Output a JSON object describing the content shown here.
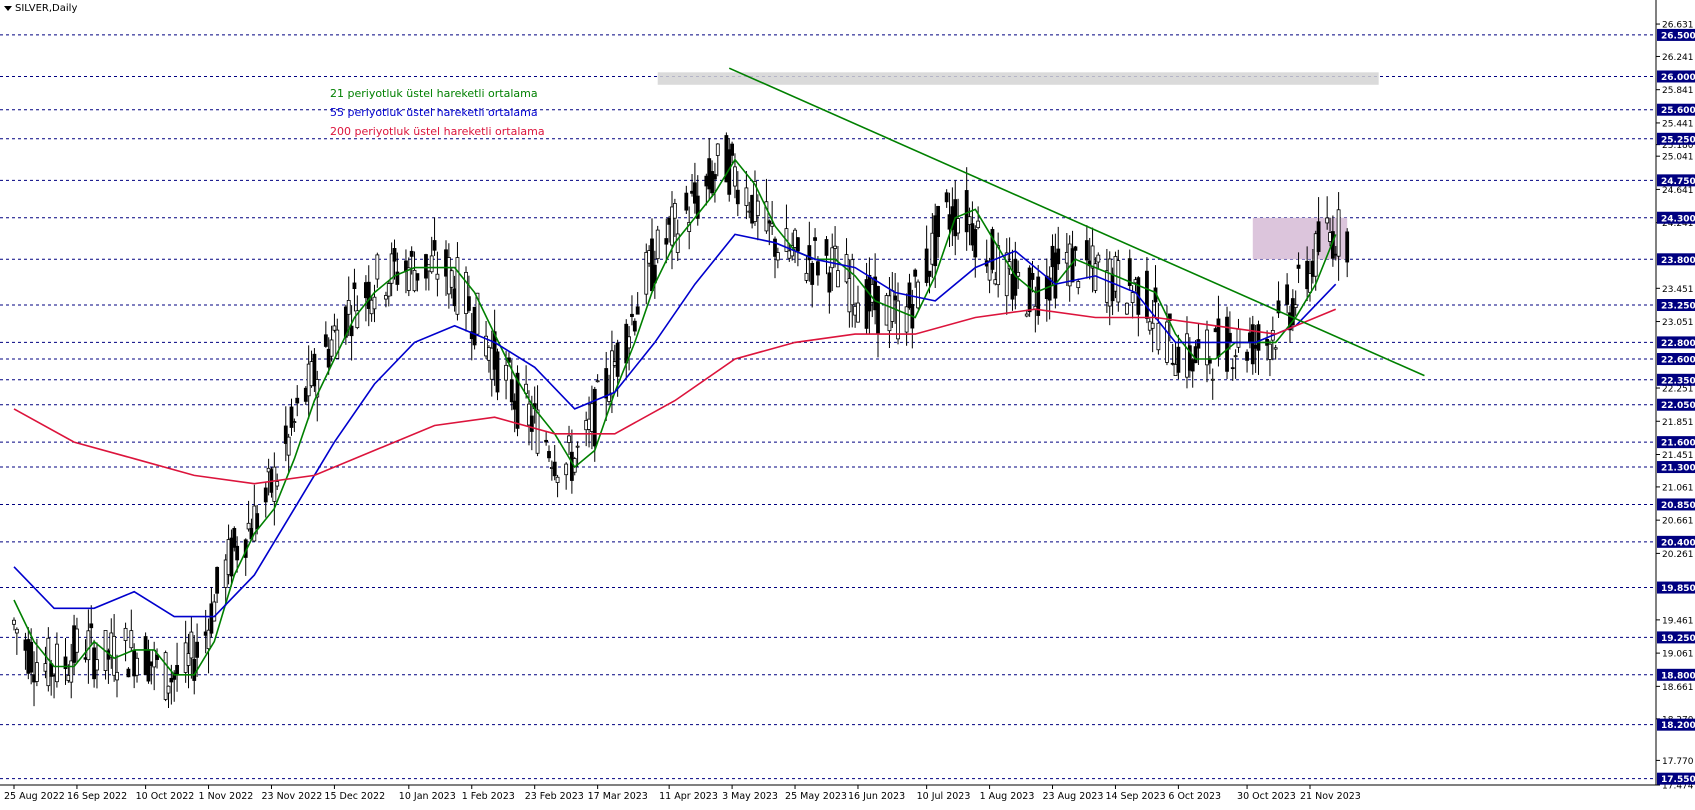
{
  "header": {
    "symbol": "SILVER,Daily"
  },
  "legend": [
    {
      "label": "21 periyotluk üstel hareketli ortalama",
      "color": "#008000"
    },
    {
      "label": "55 periyotluk üstel hareketli ortalama",
      "color": "#0000cd"
    },
    {
      "label": "200 periyotluk üstel hareketli ortalama",
      "color": "#dc143c"
    }
  ],
  "chart_data": {
    "type": "line",
    "xlabel": "",
    "ylabel": "",
    "ylim": [
      17.474,
      26.8
    ],
    "x_ticks": [
      "25 Aug 2022",
      "16 Sep 2022",
      "10 Oct 2022",
      "1 Nov 2022",
      "23 Nov 2022",
      "15 Dec 2022",
      "10 Jan 2023",
      "1 Feb 2023",
      "23 Feb 2023",
      "17 Mar 2023",
      "11 Apr 2023",
      "3 May 2023",
      "25 May 2023",
      "16 Jun 2023",
      "10 Jul 2023",
      "1 Aug 2023",
      "23 Aug 2023",
      "14 Sep 2023",
      "6 Oct 2023",
      "30 Oct 2023",
      "21 Nov 2023"
    ],
    "y_ticks": [
      "26.631",
      "26.241",
      "25.841",
      "25.441",
      "25.180",
      "25.041",
      "24.641",
      "24.241",
      "23.451",
      "23.051",
      "22.251",
      "21.851",
      "21.451",
      "21.061",
      "20.661",
      "20.261",
      "19.461",
      "19.061",
      "18.661",
      "18.270",
      "17.770",
      "17.474"
    ],
    "levels": [
      "26.500",
      "26.000",
      "25.600",
      "25.250",
      "24.750",
      "24.300",
      "23.800",
      "23.250",
      "22.800",
      "22.600",
      "22.350",
      "22.050",
      "21.600",
      "21.300",
      "20.850",
      "20.400",
      "19.850",
      "19.250",
      "18.800",
      "18.200",
      "17.550"
    ],
    "colors": {
      "ema21": "#008000",
      "ema55": "#0000cd",
      "ema200": "#dc143c",
      "candles": "#000000",
      "levels": "#000080",
      "trendline": "#008000",
      "resistance_zone": "#d3d3d3",
      "breakout_zone": "#d8bfd8",
      "label_box": "#000080"
    },
    "series": [
      {
        "name": "21 periyotluk üstel hareketli ortalama",
        "type": "line",
        "x": [
          "2022-08-25",
          "2022-09-01",
          "2022-09-08",
          "2022-09-15",
          "2022-09-22",
          "2022-09-29",
          "2022-10-06",
          "2022-10-13",
          "2022-10-20",
          "2022-10-27",
          "2022-11-03",
          "2022-11-10",
          "2022-11-17",
          "2022-11-24",
          "2022-12-01",
          "2022-12-08",
          "2022-12-15",
          "2022-12-22",
          "2022-12-29",
          "2023-01-05",
          "2023-01-12",
          "2023-01-19",
          "2023-01-26",
          "2023-02-02",
          "2023-02-09",
          "2023-02-16",
          "2023-02-23",
          "2023-03-02",
          "2023-03-09",
          "2023-03-16",
          "2023-03-23",
          "2023-03-30",
          "2023-04-06",
          "2023-04-13",
          "2023-04-20",
          "2023-04-27",
          "2023-05-04",
          "2023-05-11",
          "2023-05-18",
          "2023-05-25",
          "2023-06-01",
          "2023-06-08",
          "2023-06-15",
          "2023-06-22",
          "2023-06-29",
          "2023-07-06",
          "2023-07-13",
          "2023-07-20",
          "2023-07-27",
          "2023-08-03",
          "2023-08-10",
          "2023-08-17",
          "2023-08-24",
          "2023-08-31",
          "2023-09-07",
          "2023-09-14",
          "2023-09-21",
          "2023-09-28",
          "2023-10-05",
          "2023-10-12",
          "2023-10-19",
          "2023-10-26",
          "2023-11-02",
          "2023-11-09",
          "2023-11-16",
          "2023-11-23",
          "2023-11-30"
        ],
        "values": [
          19.7,
          19.2,
          18.9,
          18.9,
          19.2,
          19.0,
          19.1,
          19.1,
          18.8,
          18.8,
          19.2,
          20.0,
          20.5,
          20.8,
          21.4,
          22.1,
          22.6,
          23.1,
          23.4,
          23.6,
          23.7,
          23.7,
          23.7,
          23.4,
          22.9,
          22.4,
          22.0,
          21.7,
          21.3,
          21.5,
          22.2,
          22.8,
          23.5,
          24.0,
          24.3,
          24.6,
          25.0,
          24.7,
          24.2,
          23.9,
          23.8,
          23.8,
          23.6,
          23.3,
          23.2,
          23.1,
          23.6,
          24.3,
          24.4,
          24.0,
          23.6,
          23.4,
          23.5,
          23.8,
          23.7,
          23.6,
          23.5,
          23.4,
          22.9,
          22.6,
          22.6,
          22.8,
          22.8,
          22.8,
          23.1,
          23.5,
          24.1
        ]
      },
      {
        "name": "55 periyotluk üstel hareketli ortalama",
        "type": "line",
        "x": [
          "2022-08-25",
          "2022-09-08",
          "2022-09-22",
          "2022-10-06",
          "2022-10-20",
          "2022-11-03",
          "2022-11-17",
          "2022-12-01",
          "2022-12-15",
          "2022-12-29",
          "2023-01-12",
          "2023-01-26",
          "2023-02-09",
          "2023-02-23",
          "2023-03-09",
          "2023-03-23",
          "2023-04-06",
          "2023-04-20",
          "2023-05-04",
          "2023-05-18",
          "2023-06-01",
          "2023-06-15",
          "2023-06-29",
          "2023-07-13",
          "2023-07-27",
          "2023-08-10",
          "2023-08-24",
          "2023-09-07",
          "2023-09-21",
          "2023-10-05",
          "2023-10-19",
          "2023-11-02",
          "2023-11-16",
          "2023-11-30"
        ],
        "values": [
          20.1,
          19.6,
          19.6,
          19.8,
          19.5,
          19.5,
          20.0,
          20.8,
          21.6,
          22.3,
          22.8,
          23.0,
          22.8,
          22.5,
          22.0,
          22.2,
          22.8,
          23.5,
          24.1,
          24.0,
          23.8,
          23.7,
          23.4,
          23.3,
          23.7,
          23.9,
          23.5,
          23.6,
          23.4,
          22.8,
          22.8,
          22.8,
          23.0,
          23.5
        ]
      },
      {
        "name": "200 periyotluk üstel hareketli ortalama",
        "type": "line",
        "x": [
          "2022-08-25",
          "2022-09-15",
          "2022-10-06",
          "2022-10-27",
          "2022-11-17",
          "2022-12-08",
          "2022-12-29",
          "2023-01-19",
          "2023-02-09",
          "2023-03-02",
          "2023-03-23",
          "2023-04-13",
          "2023-05-04",
          "2023-05-25",
          "2023-06-15",
          "2023-07-06",
          "2023-07-27",
          "2023-08-17",
          "2023-09-07",
          "2023-09-28",
          "2023-10-19",
          "2023-11-09",
          "2023-11-30"
        ],
        "values": [
          22.0,
          21.6,
          21.4,
          21.2,
          21.1,
          21.2,
          21.5,
          21.8,
          21.9,
          21.7,
          21.7,
          22.1,
          22.6,
          22.8,
          22.9,
          22.9,
          23.1,
          23.2,
          23.1,
          23.1,
          23.0,
          22.9,
          23.2
        ]
      }
    ],
    "annotations": [
      {
        "type": "trendline",
        "from": [
          "2023-05-02",
          26.1
        ],
        "to": [
          "2023-12-31",
          22.4
        ]
      },
      {
        "type": "resistance_zone",
        "y_range": [
          25.9,
          26.05
        ]
      },
      {
        "type": "breakout_zone",
        "y_range": [
          23.8,
          24.3
        ]
      }
    ]
  }
}
